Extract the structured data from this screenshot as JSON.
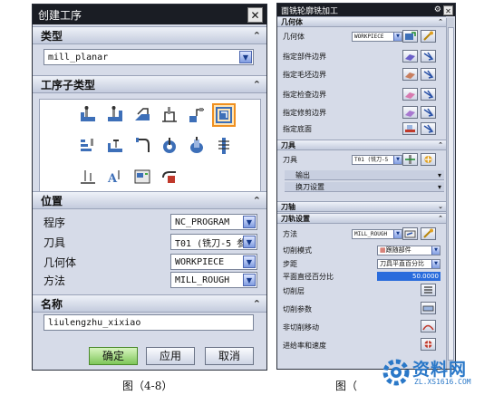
{
  "left_dialog": {
    "title": "创建工序",
    "sections": {
      "type": "类型",
      "subtype": "工序子类型",
      "location": "位置",
      "name": "名称"
    },
    "type_value": "mill_planar",
    "location": [
      {
        "label": "程序",
        "value": "NC_PROGRAM"
      },
      {
        "label": "刀具",
        "value": "T01 (铣刀-5 参"
      },
      {
        "label": "几何体",
        "value": "WORKPIECE"
      },
      {
        "label": "方法",
        "value": "MILL_ROUGH"
      }
    ],
    "name_value": "liulengzhu_xixiao",
    "buttons": {
      "ok": "确定",
      "apply": "应用",
      "cancel": "取消"
    }
  },
  "right_dialog": {
    "title": "面铣轮廓铣加工",
    "sections": {
      "geometry": "几何体",
      "tool": "刀具",
      "axis": "刀轴",
      "path": "刀轨设置"
    },
    "geometry": {
      "label": "几何体",
      "value": "WORKPIECE",
      "rows": [
        "指定部件边界",
        "指定毛坯边界",
        "指定检查边界",
        "指定修剪边界",
        "指定底面"
      ]
    },
    "tool": {
      "label": "刀具",
      "value": "T01 (铣刀-5",
      "subs": [
        "输出",
        "换刀设置"
      ]
    },
    "path": {
      "method_label": "方法",
      "method_value": "MILL_ROUGH",
      "pattern_label": "切削模式",
      "pattern_value": "跟随部件",
      "step_label": "步距",
      "step_value": "刀具平直百分比",
      "pct_label": "平面直径百分比",
      "pct_value": "50.0000",
      "rows": [
        "切削层",
        "切削参数",
        "非切削移动",
        "进给率和速度"
      ]
    }
  },
  "captions": {
    "left": "图（4-8）",
    "right": "图（"
  },
  "watermark": {
    "text": "资料网",
    "url": "ZL.XS1616.COM"
  },
  "colors": {
    "titlebar": "#1a1d24",
    "panel": "#d6dbe8",
    "ok_button": "#7fc65a",
    "selected_icon": "#f09020",
    "watermark": "#2a78c8"
  }
}
